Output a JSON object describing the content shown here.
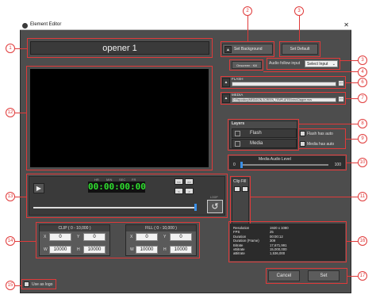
{
  "window": {
    "title": "Element Editor",
    "close_glyph": "✕"
  },
  "element_name": "opener 1",
  "buttons": {
    "set_background": "Set Background",
    "set_default": "Set Default",
    "onscreen_kill": "Onscreen : Kill",
    "cancel": "Cancel",
    "set": "Set"
  },
  "audio_follow": {
    "label": "Audio follow input",
    "value": "Select Input"
  },
  "flash": {
    "label": "FLASH"
  },
  "media": {
    "label": "MEDIA",
    "path": "D:\\Repository\\MEDIA\\ON-SCREEN_TEMPLATES\\Intro\\Clapper.mov"
  },
  "layers": {
    "title": "Layers",
    "items": [
      "Flash",
      "Media"
    ]
  },
  "checkboxes": {
    "flash_auto": "Flash has auto",
    "media_auto": "Media has auto",
    "use_as_logo": "Use as logo"
  },
  "media_audio": {
    "label": "Media Audio Level",
    "min": "0",
    "max": "100",
    "level": 0
  },
  "clip_fill": {
    "label": "Clip Fill"
  },
  "timecode": {
    "labels": [
      "HR",
      "MIN",
      "SEC",
      "FR"
    ],
    "value": "00:00:00:00"
  },
  "transport": {
    "buttons": [
      "<<",
      ">>",
      "<",
      ">"
    ],
    "loop_label": "LOOP"
  },
  "clip": {
    "title": "CLIP ( 0 - 10,000 )",
    "x": "0",
    "y": "0",
    "w": "10000",
    "h": "10000"
  },
  "fill": {
    "title": "FILL ( 0 - 10,000 )",
    "x": "0",
    "y": "0",
    "w": "10000",
    "h": "10000"
  },
  "axis_labels": {
    "x": "X",
    "y": "Y",
    "w": "W",
    "h": "H"
  },
  "info": [
    {
      "key": "Resolution",
      "value": "1920 x 1080"
    },
    {
      "key": "FPS",
      "value": "25"
    },
    {
      "key": "Duration",
      "value": "00:00:12"
    },
    {
      "key": "Duration (Frame)",
      "value": "309"
    },
    {
      "key": "Bitrate",
      "value": "17,671,991"
    },
    {
      "key": "vBitrate",
      "value": "15,000,000"
    },
    {
      "key": "aBitrate",
      "value": "1,536,000"
    }
  ],
  "markers": [
    "1",
    "2",
    "3",
    "4",
    "5",
    "6",
    "7",
    "8",
    "9",
    "10",
    "11",
    "12",
    "13",
    "14",
    "15",
    "16",
    "17"
  ],
  "colors": {
    "marker": "#e03a3a",
    "timecode": "#2fe02f",
    "window_bg": "#4d4d4d"
  }
}
